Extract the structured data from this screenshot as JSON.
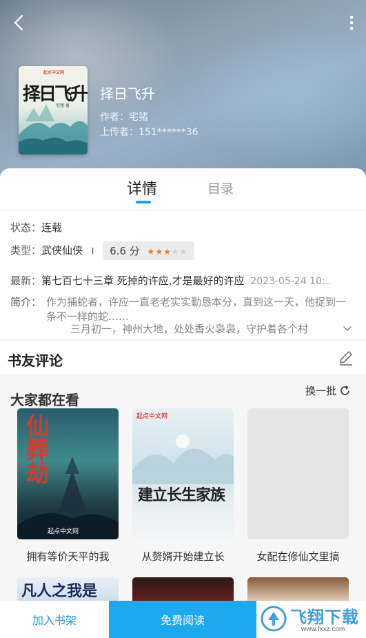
{
  "book": {
    "title": "择日飞升",
    "author": "作者：宅猪",
    "uploader": "上传者：151******36",
    "cover_title": "择日飞升",
    "cover_author": "宅猪 著",
    "cover_badge": "起点中文网"
  },
  "tabs": [
    {
      "label": "详情",
      "active": true
    },
    {
      "label": "目录",
      "active": false
    }
  ],
  "details": {
    "status_label": "状态：",
    "status_value": "连载",
    "type_label": "类型：",
    "type_value": "武侠仙侠",
    "separator": "I",
    "rating": "6.6 分",
    "rating_value": 3.3,
    "rating_max": 5,
    "latest_label": "最新：",
    "latest_value": "第七百七十三章 死掉的许应,才是最好的许应",
    "latest_date": "2023-05-24 10:..",
    "intro_label": "简介：",
    "intro_text": "作为捕蛇者，许应一直老老实实勤恳本分，直到这一天，他捉到一条不一样的蛇……",
    "intro_more": "三月初一，神州大地，处处香火袅袅，守护着各个村"
  },
  "reviews": {
    "title": "书友评论"
  },
  "recommend": {
    "title": "大家都在看",
    "refresh_label": "换一批",
    "books": [
      {
        "title": "拥有等价天平的我",
        "cover_text": "仙葬劫",
        "brand": "起点中文网"
      },
      {
        "title": "从赘婿开始建立长",
        "cover_text": "建立长生家族",
        "brand": "起点中文网"
      },
      {
        "title": "女配在修仙文里搞",
        "cover_text": "",
        "brand": ""
      }
    ],
    "peek_text": "凡人之我是"
  },
  "actions": {
    "add_shelf": "加入书架",
    "read_free": "免费阅读"
  },
  "watermark": {
    "main": "飞翔下载",
    "sub": "www.fxxz.com"
  },
  "colors": {
    "accent": "#1ea8f0",
    "star": "#f07a1c"
  }
}
